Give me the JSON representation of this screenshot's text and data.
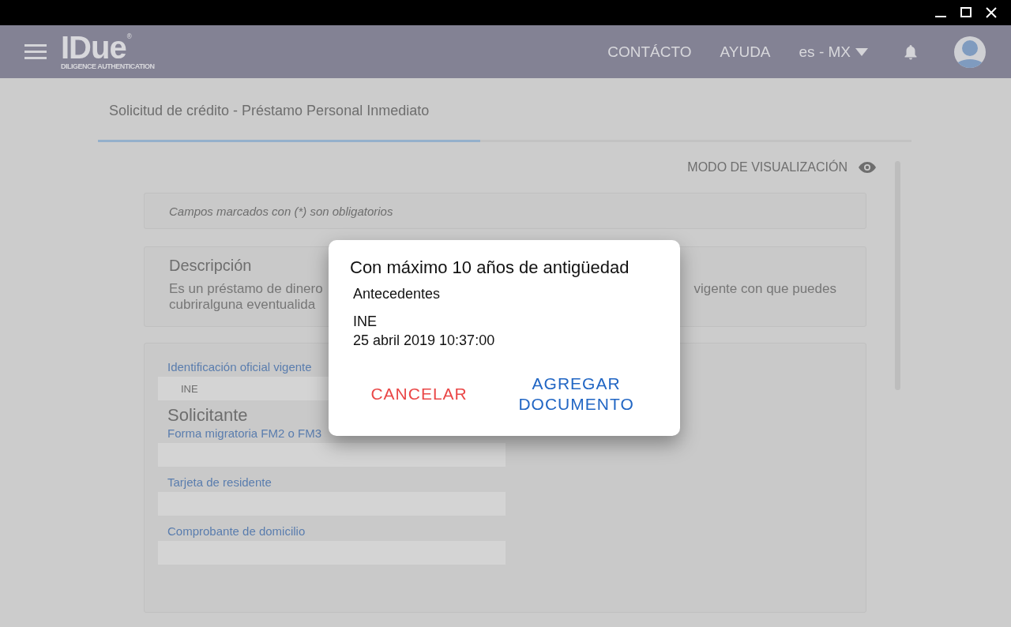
{
  "header": {
    "logo": {
      "name": "IDue",
      "mark": "®",
      "tagline": "DILIGENCE AUTHENTICATION"
    },
    "nav": [
      {
        "label": "CONTÁCTO"
      },
      {
        "label": "AYUDA"
      }
    ],
    "language": "es - MX"
  },
  "tabs": [
    {
      "label": "Solicitud de crédito  - Préstamo Personal Inmediato",
      "selected": true
    }
  ],
  "view_mode": "MODO DE VISUALIZACIÓN",
  "notice": "Campos marcados con (*) son obligatorios",
  "description": {
    "title": "Descripción",
    "left_lines": [
      "Es un préstamo de dinero",
      "cubriralguna eventualida"
    ],
    "right_lines": [
      "vigente con que puedes"
    ]
  },
  "document_fields": [
    {
      "label": "Identificación oficial vigente",
      "value": "INE"
    }
  ],
  "section_title": "Solicitante",
  "applicant_fields": [
    {
      "label": "Forma migratoria FM2 o FM3"
    },
    {
      "label": "Tarjeta de residente"
    },
    {
      "label": "Comprobante de domicilio"
    }
  ],
  "dialog": {
    "title": "Con máximo 10 años de antigüedad",
    "subtitle": "Antecedentes",
    "document": "INE",
    "date": "25 abril 2019 10:37:00",
    "buttons": [
      {
        "label": "CANCELAR",
        "kind": "cancel"
      },
      {
        "label": "AGREGAR DOCUMENTO",
        "kind": "confirm"
      }
    ]
  }
}
